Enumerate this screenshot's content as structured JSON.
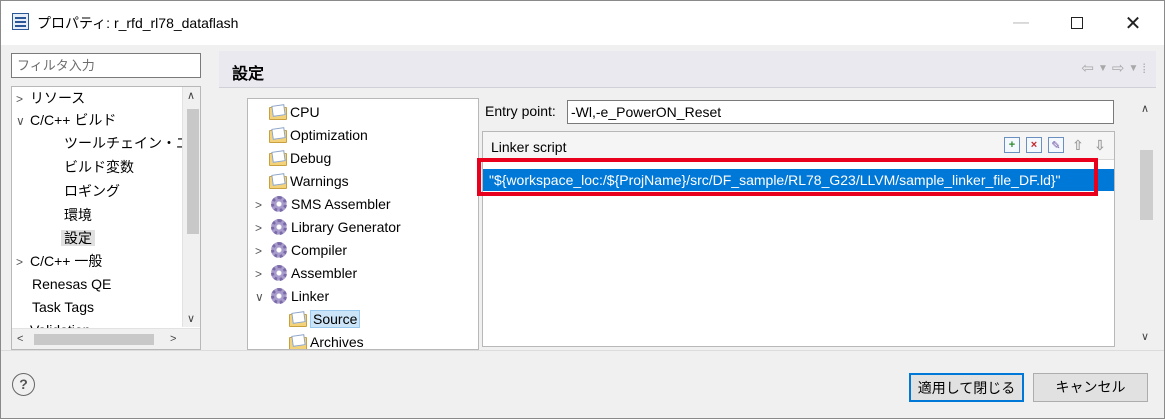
{
  "window": {
    "title": "プロパティ: r_rfd_rl78_dataflash"
  },
  "filter": {
    "placeholder": "フィルタ入力"
  },
  "left_tree": {
    "items": [
      {
        "twisty": ">",
        "label": "リソース"
      },
      {
        "twisty": "∨",
        "label": "C/C++ ビルド"
      },
      {
        "twisty": "",
        "label": "ツールチェイン・エディ"
      },
      {
        "twisty": "",
        "label": "ビルド変数"
      },
      {
        "twisty": "",
        "label": "ロギング"
      },
      {
        "twisty": "",
        "label": "環境"
      },
      {
        "twisty": "",
        "label": "設定"
      },
      {
        "twisty": ">",
        "label": "C/C++ 一般"
      },
      {
        "twisty": "",
        "label": "Renesas QE"
      },
      {
        "twisty": "",
        "label": "Task Tags"
      },
      {
        "twisty": ">",
        "label": "Validation"
      }
    ]
  },
  "header": {
    "title": "設定"
  },
  "tool_tree": {
    "items": [
      {
        "twisty": "",
        "icon": "folder-icon",
        "label": "CPU"
      },
      {
        "twisty": "",
        "icon": "folder-icon",
        "label": "Optimization"
      },
      {
        "twisty": "",
        "icon": "folder-icon",
        "label": "Debug"
      },
      {
        "twisty": "",
        "icon": "folder-icon",
        "label": "Warnings"
      },
      {
        "twisty": ">",
        "icon": "gear-icon",
        "label": "SMS Assembler"
      },
      {
        "twisty": ">",
        "icon": "gear-icon",
        "label": "Library Generator"
      },
      {
        "twisty": ">",
        "icon": "gear-icon",
        "label": "Compiler"
      },
      {
        "twisty": ">",
        "icon": "gear-icon",
        "label": "Assembler"
      },
      {
        "twisty": "∨",
        "icon": "gear-icon",
        "label": "Linker"
      },
      {
        "twisty": "",
        "icon": "folder-icon",
        "label": "Source"
      },
      {
        "twisty": "",
        "icon": "folder-icon",
        "label": "Archives"
      }
    ]
  },
  "entry_point": {
    "label": "Entry point:",
    "value": "-Wl,-e_PowerON_Reset"
  },
  "linker_script": {
    "label": "Linker script",
    "path": "\"${workspace_loc:/${ProjName}/src/DF_sample/RL78_G23/LLVM/sample_linker_file_DF.ld}\""
  },
  "footer": {
    "help": "?",
    "apply_close": "適用して閉じる",
    "cancel": "キャンセル"
  },
  "colors": {
    "selection": "#0078d7",
    "highlight_frame": "#e8001c"
  }
}
